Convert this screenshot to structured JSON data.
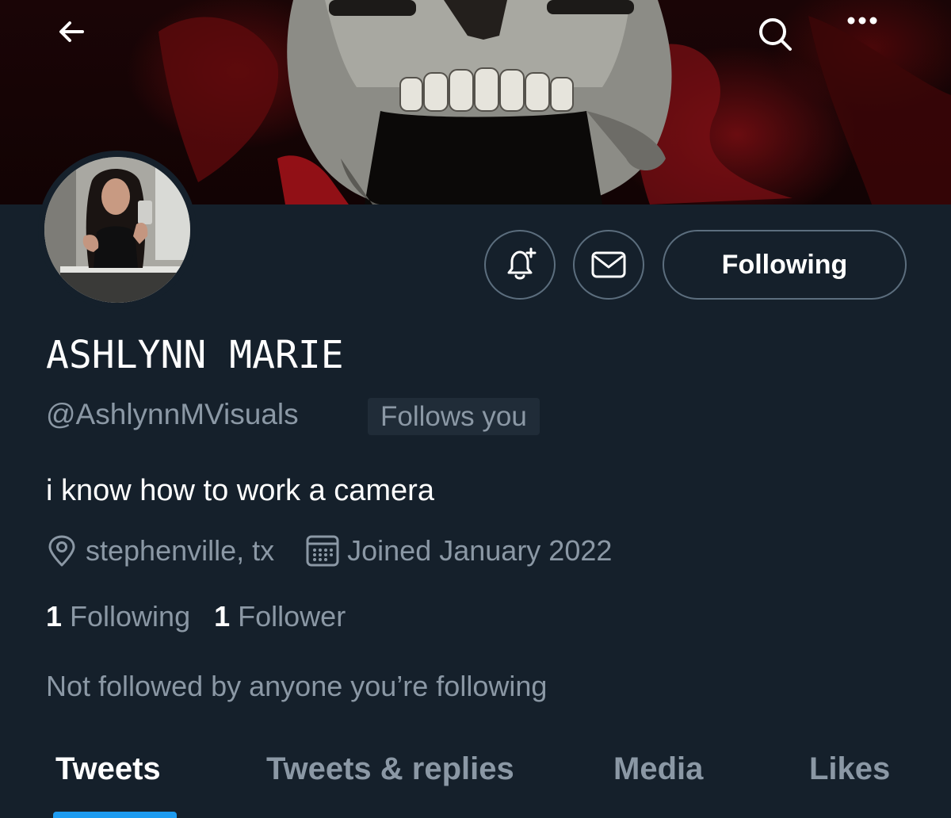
{
  "header": {
    "back_icon": "arrow-left-icon",
    "search_icon": "search-icon",
    "more_icon": "more-horizontal-icon"
  },
  "profile": {
    "display_name": "ASHLYNN MARIE",
    "handle": "@AshlynnMVisuals",
    "follows_you_badge": "Follows you",
    "bio": "i know how to work a camera",
    "location": "stephenville, tx",
    "joined": "Joined January 2022",
    "following_count": "1",
    "following_label": "Following",
    "followers_count": "1",
    "followers_label": "Follower",
    "mutuals_text": "Not followed by anyone you’re following"
  },
  "actions": {
    "notify_icon": "bell-plus-icon",
    "message_icon": "envelope-icon",
    "following_button": "Following"
  },
  "tabs": [
    {
      "label": "Tweets",
      "active": true
    },
    {
      "label": "Tweets & replies",
      "active": false
    },
    {
      "label": "Media",
      "active": false
    },
    {
      "label": "Likes",
      "active": false
    }
  ],
  "colors": {
    "background": "#15202b",
    "secondary_text": "#8b98a5",
    "accent": "#1d9bf0",
    "border": "#5c6e7e"
  }
}
